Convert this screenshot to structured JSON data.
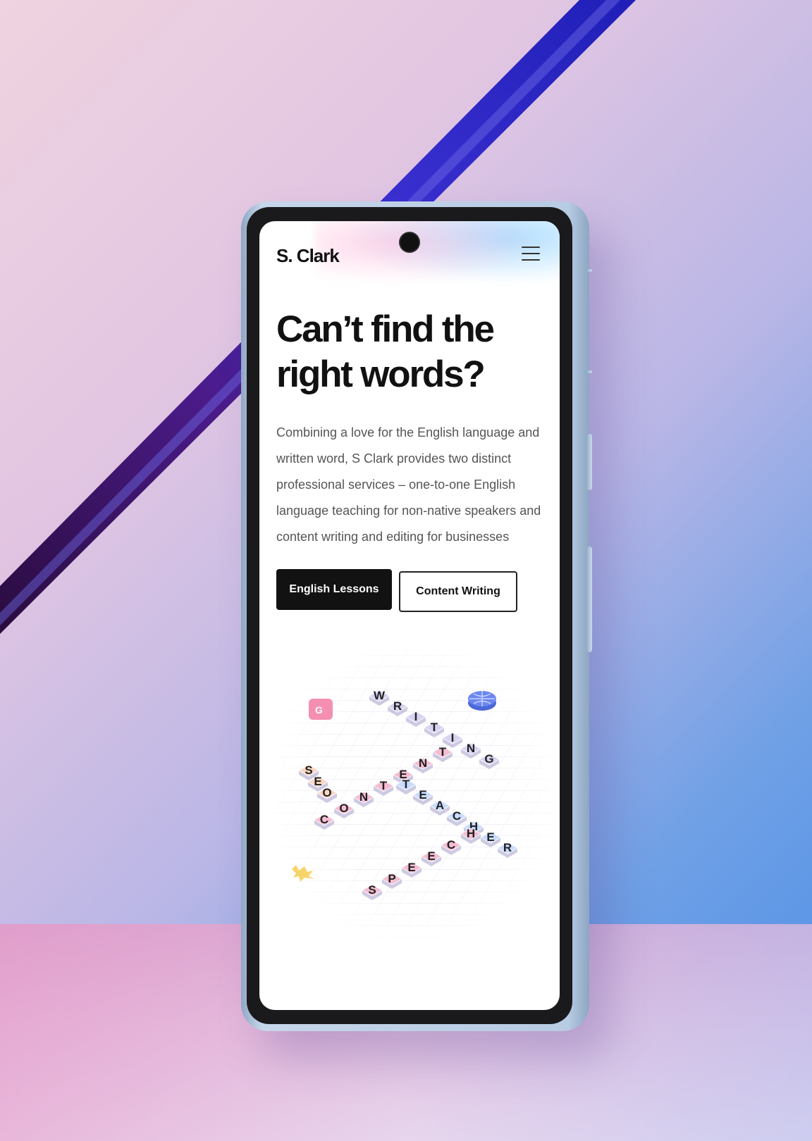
{
  "site": {
    "brand": "S. Clark",
    "menu_icon": "hamburger-menu-icon"
  },
  "hero": {
    "headline": "Can’t find the right words?",
    "intro": "Combining a love for the English language and written word, S Clark provides two distinct professional services – one-to-one English language teaching for non-native speakers and content writing and editing for businesses"
  },
  "buttons": {
    "english_lessons": "English Lessons",
    "content_writing": "Content Writing"
  },
  "illustration": {
    "words": [
      {
        "text": "WRITING",
        "letters": [
          "W",
          "R",
          "I",
          "T",
          "I",
          "N",
          "G"
        ]
      },
      {
        "text": "SEO",
        "letters": [
          "S",
          "E",
          "O"
        ]
      },
      {
        "text": "CONTENT",
        "letters": [
          "C",
          "O",
          "N",
          "T",
          "E",
          "N",
          "T"
        ]
      },
      {
        "text": "TEACHER",
        "letters": [
          "T",
          "E",
          "A",
          "C",
          "H",
          "E",
          "R"
        ]
      },
      {
        "text": "SPEECH",
        "letters": [
          "S",
          "P",
          "E",
          "E",
          "C",
          "H"
        ]
      }
    ],
    "icons": [
      "translate-icon",
      "globe-icon",
      "sparkle-icon"
    ],
    "tile_colors": {
      "pink": "#f5bdd2",
      "lavender": "#d9d3f2",
      "blue": "#c9dcff",
      "peach": "#fbd8c4"
    }
  },
  "colors": {
    "stripe": "#2a22c9",
    "phone_frame": "#b7cbe3",
    "button_primary": "#121212"
  }
}
